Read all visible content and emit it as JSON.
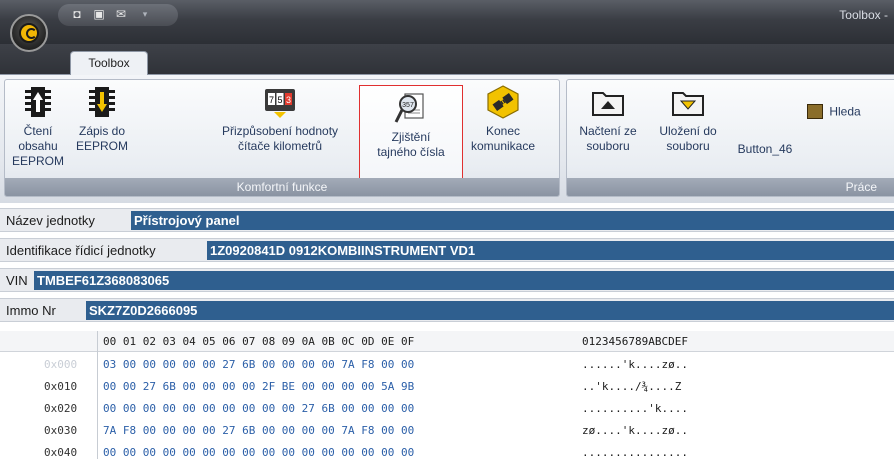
{
  "window": {
    "title": "Toolbox -"
  },
  "ribbon": {
    "tab": "Toolbox",
    "groups": [
      {
        "label": "Komfortní funkce",
        "buttons": [
          {
            "label1": "Čtení obsahu",
            "label2": "EEPROM",
            "icon": "chip-read-icon"
          },
          {
            "label1": "Zápis do",
            "label2": "EEPROM",
            "icon": "chip-write-icon"
          },
          {
            "label1": "Přizpůsobení hodnoty",
            "label2": "čítače kilometrů",
            "icon": "odometer-icon"
          },
          {
            "label1": "Zjištění",
            "label2": "tajného čísla",
            "icon": "secret-magnifier-icon"
          },
          {
            "label1": "Konec",
            "label2": "komunikace",
            "icon": "disconnect-icon"
          }
        ]
      },
      {
        "label": "Práce",
        "buttons": [
          {
            "label1": "Načtení ze",
            "label2": "souboru",
            "icon": "folder-open-icon"
          },
          {
            "label1": "Uložení do",
            "label2": "souboru",
            "icon": "folder-save-icon"
          },
          {
            "label1": "Button_46",
            "label2": "",
            "icon": ""
          },
          {
            "label1": "Hleda",
            "label2": "",
            "icon": "binoculars-icon"
          }
        ]
      }
    ]
  },
  "info": {
    "unit_name": {
      "label": "Název jednotky",
      "value": "Přístrojový panel"
    },
    "ecu_id": {
      "label": "Identifikace řídicí jednotky",
      "value": "1Z0920841D  0912KOMBIINSTRUMENT VD1"
    },
    "vin": {
      "label": "VIN",
      "value": "TMBEF61Z368083065"
    },
    "immo": {
      "label": "Immo Nr",
      "value": "SKZ7Z0D2666095"
    }
  },
  "hex": {
    "header_bytes": "00 01 02 03 04 05 06 07 08 09 0A 0B 0C 0D 0E 0F",
    "header_ascii": "0123456789ABCDEF",
    "rows": [
      {
        "addr": "0x000",
        "bytes": "03 00 00 00 00 00 27 6B 00 00 00 00 7A F8 00 00",
        "ascii": "......'k....zø.."
      },
      {
        "addr": "0x010",
        "bytes": "00 00 27 6B 00 00 00 00 2F BE 00 00 00 00 5A 9B",
        "ascii": "..'k..../¾....Z"
      },
      {
        "addr": "0x020",
        "bytes": "00 00 00 00 00 00 00 00 00 00 27 6B 00 00 00 00",
        "ascii": "..........'k...."
      },
      {
        "addr": "0x030",
        "bytes": "7A F8 00 00 00 00 27 6B 00 00 00 00 7A F8 00 00",
        "ascii": "zø....'k....zø.."
      },
      {
        "addr": "0x040",
        "bytes": "00 00 00 00 00 00 00 00 00 00 00 00 00 00 00 00",
        "ascii": "................"
      }
    ]
  }
}
